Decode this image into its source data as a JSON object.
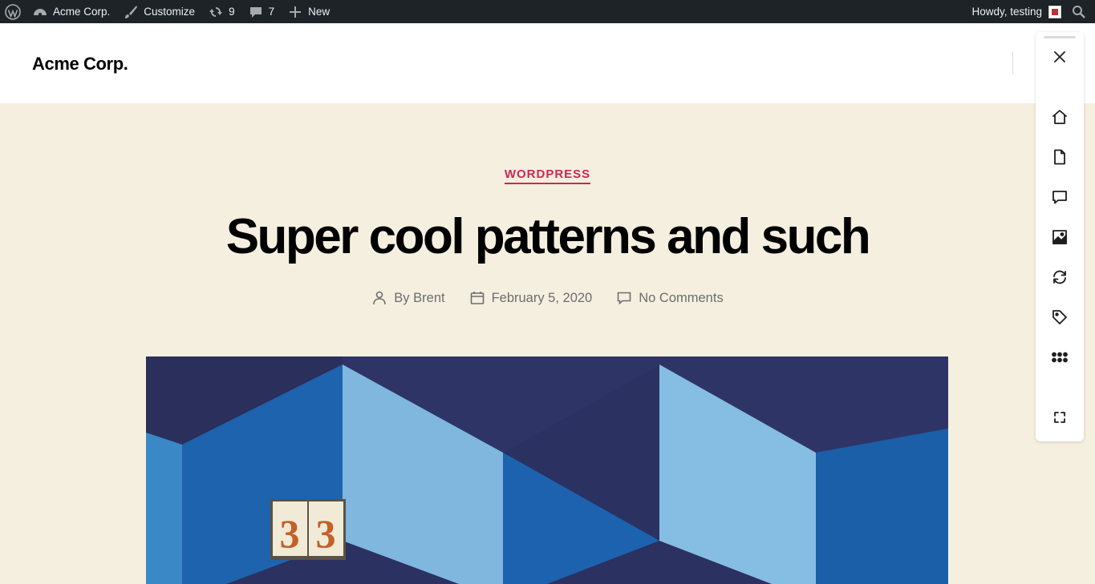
{
  "admin_bar": {
    "wp_logo": "wordpress-logo-icon",
    "site_name": "Acme Corp.",
    "customize": "Customize",
    "updates_count": "9",
    "comments_count": "7",
    "new_label": "New",
    "howdy": "Howdy, testing"
  },
  "site": {
    "title": "Acme Corp."
  },
  "post": {
    "category": "WORDPRESS",
    "title": "Super cool patterns and such",
    "author": "By Brent",
    "date": "February 5, 2020",
    "comments": "No Comments"
  },
  "featured_image": {
    "tile_numbers": "33"
  },
  "toolbar": {
    "buttons": [
      "close-icon",
      "home-icon",
      "page-icon",
      "comment-icon",
      "image-icon",
      "update-icon",
      "tag-icon",
      "more-icon",
      "fullscreen-icon"
    ]
  },
  "colors": {
    "admin_bar_bg": "#1d2327",
    "accent": "#cd2653",
    "page_bg": "#f5efe0"
  }
}
